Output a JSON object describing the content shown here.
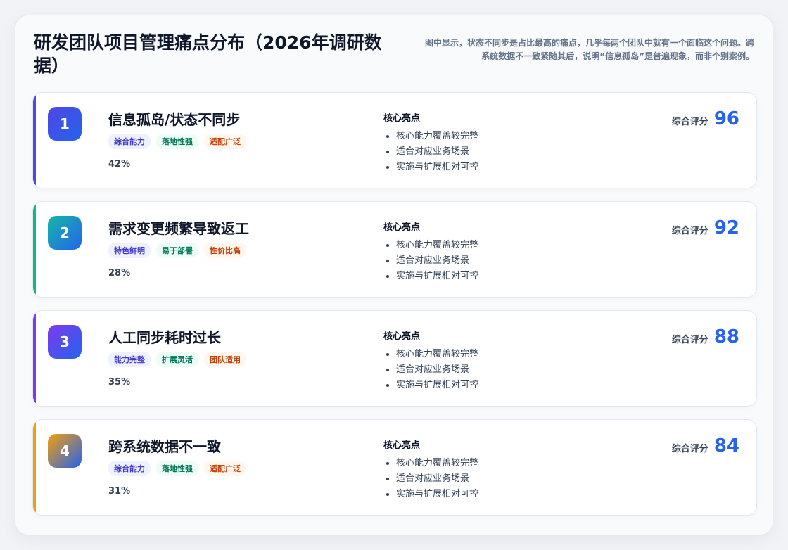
{
  "header": {
    "title": "研发团队项目管理痛点分布（2026年调研数据）",
    "description": "图中显示，状态不同步是占比最高的痛点，几乎每两个团队中就有一个面临这个问题。跨系统数据不一致紧随其后，说明“信息孤岛”是普遍现象，而非个别案例。"
  },
  "highlights_label": "核心亮点",
  "score_label": "综合评分",
  "items": [
    {
      "rank": "1",
      "name": "信息孤岛/状态不同步",
      "tags": [
        "综合能力",
        "落地性强",
        "适配广泛"
      ],
      "percent": "42%",
      "highlights": [
        "核心能力覆盖较完整",
        "适合对应业务场景",
        "实施与扩展相对可控"
      ],
      "score": "96",
      "accent": "#4f46e5",
      "badge_gradient": [
        "#4f46e5",
        "#2563eb"
      ]
    },
    {
      "rank": "2",
      "name": "需求变更频繁导致返工",
      "tags": [
        "特色鲜明",
        "易于部署",
        "性价比高"
      ],
      "percent": "28%",
      "highlights": [
        "核心能力覆盖较完整",
        "适合对应业务场景",
        "实施与扩展相对可控"
      ],
      "score": "92",
      "accent": "#10b981",
      "badge_gradient": [
        "#14b8a6",
        "#2563eb"
      ]
    },
    {
      "rank": "3",
      "name": "人工同步耗时过长",
      "tags": [
        "能力完整",
        "扩展灵活",
        "团队适用"
      ],
      "percent": "35%",
      "highlights": [
        "核心能力覆盖较完整",
        "适合对应业务场景",
        "实施与扩展相对可控"
      ],
      "score": "88",
      "accent": "#7c3aed",
      "badge_gradient": [
        "#7c3aed",
        "#2563eb"
      ]
    },
    {
      "rank": "4",
      "name": "跨系统数据不一致",
      "tags": [
        "综合能力",
        "落地性强",
        "适配广泛"
      ],
      "percent": "31%",
      "highlights": [
        "核心能力覆盖较完整",
        "适合对应业务场景",
        "实施与扩展相对可控"
      ],
      "score": "84",
      "accent": "#f59e0b",
      "badge_gradient": [
        "#f59e0b",
        "#2563eb"
      ]
    }
  ]
}
